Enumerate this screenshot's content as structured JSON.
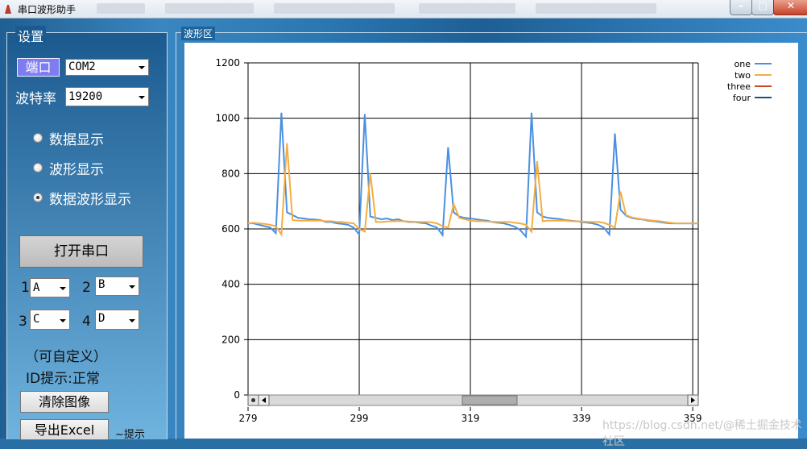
{
  "window": {
    "title": "串口波形助手",
    "controls": [
      "–",
      "□",
      "✕"
    ]
  },
  "settings": {
    "group_label": "设置",
    "port_button": "端口",
    "port_value": "COM2",
    "baud_label": "波特率",
    "baud_value": "19200",
    "radios": [
      {
        "label": "数据显示",
        "checked": false
      },
      {
        "label": "波形显示",
        "checked": false
      },
      {
        "label": "数据波形显示",
        "checked": true
      }
    ],
    "open_button": "打开串口",
    "channels": [
      {
        "num": "1",
        "value": "A"
      },
      {
        "num": "2",
        "value": "B"
      },
      {
        "num": "3",
        "value": "C"
      },
      {
        "num": "4",
        "value": "D"
      }
    ],
    "custom_note": "（可自定义）",
    "id_status": "ID提示:正常",
    "clear_button": "清除图像",
    "export_button": "导出Excel",
    "hint": "~提示"
  },
  "plot_group_label": "波形区",
  "watermark": "https://blog.csdn.net/@稀土掘金技术社区",
  "watermark_right": "@稀土掘金技术社区",
  "chart_data": {
    "type": "line",
    "xlim": [
      279,
      360
    ],
    "ylim": [
      0,
      1200
    ],
    "x_ticks": [
      "279",
      "299",
      "319",
      "339",
      "359"
    ],
    "y_ticks": [
      "0",
      "200",
      "400",
      "600",
      "800",
      "1000",
      "1200"
    ],
    "grid": true,
    "legend_position": "top-right",
    "series": [
      {
        "name": "one",
        "color": "#4a90e2",
        "points": [
          [
            279,
            620
          ],
          [
            280,
            620
          ],
          [
            281,
            615
          ],
          [
            282,
            610
          ],
          [
            283,
            605
          ],
          [
            284,
            585
          ],
          [
            285,
            1020
          ],
          [
            286,
            660
          ],
          [
            287,
            650
          ],
          [
            288,
            640
          ],
          [
            289,
            638
          ],
          [
            290,
            635
          ],
          [
            291,
            634
          ],
          [
            292,
            632
          ],
          [
            293,
            625
          ],
          [
            294,
            625
          ],
          [
            295,
            620
          ],
          [
            296,
            618
          ],
          [
            297,
            615
          ],
          [
            298,
            605
          ],
          [
            299,
            580
          ],
          [
            300,
            1015
          ],
          [
            301,
            645
          ],
          [
            302,
            640
          ],
          [
            303,
            635
          ],
          [
            304,
            638
          ],
          [
            305,
            632
          ],
          [
            306,
            635
          ],
          [
            307,
            628
          ],
          [
            308,
            625
          ],
          [
            309,
            625
          ],
          [
            310,
            622
          ],
          [
            311,
            620
          ],
          [
            312,
            612
          ],
          [
            313,
            605
          ],
          [
            314,
            578
          ],
          [
            315,
            895
          ],
          [
            316,
            660
          ],
          [
            317,
            645
          ],
          [
            318,
            640
          ],
          [
            319,
            638
          ],
          [
            320,
            635
          ],
          [
            321,
            632
          ],
          [
            322,
            630
          ],
          [
            323,
            625
          ],
          [
            324,
            622
          ],
          [
            325,
            620
          ],
          [
            326,
            615
          ],
          [
            327,
            608
          ],
          [
            328,
            595
          ],
          [
            329,
            572
          ],
          [
            330,
            1020
          ],
          [
            331,
            660
          ],
          [
            332,
            645
          ],
          [
            333,
            640
          ],
          [
            334,
            638
          ],
          [
            335,
            636
          ],
          [
            336,
            632
          ],
          [
            337,
            630
          ],
          [
            338,
            628
          ],
          [
            339,
            625
          ],
          [
            340,
            623
          ],
          [
            341,
            620
          ],
          [
            342,
            615
          ],
          [
            343,
            605
          ],
          [
            344,
            580
          ],
          [
            345,
            945
          ],
          [
            346,
            670
          ],
          [
            347,
            648
          ],
          [
            348,
            640
          ],
          [
            349,
            636
          ],
          [
            350,
            634
          ],
          [
            351,
            630
          ],
          [
            352,
            628
          ],
          [
            353,
            625
          ],
          [
            354,
            622
          ],
          [
            355,
            620
          ],
          [
            356,
            620
          ],
          [
            357,
            620
          ],
          [
            358,
            620
          ],
          [
            359,
            620
          ],
          [
            360,
            620
          ]
        ]
      },
      {
        "name": "two",
        "color": "#f4ad42",
        "points": [
          [
            279,
            620
          ],
          [
            280,
            622
          ],
          [
            281,
            620
          ],
          [
            282,
            618
          ],
          [
            283,
            615
          ],
          [
            284,
            610
          ],
          [
            285,
            580
          ],
          [
            286,
            910
          ],
          [
            287,
            632
          ],
          [
            288,
            630
          ],
          [
            289,
            630
          ],
          [
            290,
            630
          ],
          [
            291,
            630
          ],
          [
            292,
            630
          ],
          [
            293,
            628
          ],
          [
            294,
            628
          ],
          [
            295,
            625
          ],
          [
            296,
            625
          ],
          [
            297,
            622
          ],
          [
            298,
            620
          ],
          [
            299,
            600
          ],
          [
            300,
            590
          ],
          [
            301,
            800
          ],
          [
            302,
            625
          ],
          [
            303,
            625
          ],
          [
            304,
            627
          ],
          [
            305,
            628
          ],
          [
            306,
            628
          ],
          [
            307,
            628
          ],
          [
            308,
            627
          ],
          [
            309,
            626
          ],
          [
            310,
            625
          ],
          [
            311,
            625
          ],
          [
            312,
            624
          ],
          [
            313,
            620
          ],
          [
            314,
            610
          ],
          [
            315,
            605
          ],
          [
            316,
            690
          ],
          [
            317,
            640
          ],
          [
            318,
            635
          ],
          [
            319,
            630
          ],
          [
            320,
            628
          ],
          [
            321,
            628
          ],
          [
            322,
            627
          ],
          [
            323,
            626
          ],
          [
            324,
            625
          ],
          [
            325,
            625
          ],
          [
            326,
            625
          ],
          [
            327,
            622
          ],
          [
            328,
            620
          ],
          [
            329,
            615
          ],
          [
            330,
            590
          ],
          [
            331,
            845
          ],
          [
            332,
            628
          ],
          [
            333,
            630
          ],
          [
            334,
            630
          ],
          [
            335,
            630
          ],
          [
            336,
            630
          ],
          [
            337,
            628
          ],
          [
            338,
            628
          ],
          [
            339,
            627
          ],
          [
            340,
            626
          ],
          [
            341,
            625
          ],
          [
            342,
            625
          ],
          [
            343,
            622
          ],
          [
            344,
            615
          ],
          [
            345,
            605
          ],
          [
            346,
            735
          ],
          [
            347,
            650
          ],
          [
            348,
            642
          ],
          [
            349,
            638
          ],
          [
            350,
            635
          ],
          [
            351,
            632
          ],
          [
            352,
            630
          ],
          [
            353,
            628
          ],
          [
            354,
            625
          ],
          [
            355,
            622
          ],
          [
            356,
            620
          ],
          [
            357,
            620
          ],
          [
            358,
            620
          ],
          [
            359,
            620
          ],
          [
            360,
            620
          ]
        ]
      },
      {
        "name": "three",
        "color": "#c94b1c",
        "points": []
      },
      {
        "name": "four",
        "color": "#1f4f7a",
        "points": []
      }
    ]
  }
}
